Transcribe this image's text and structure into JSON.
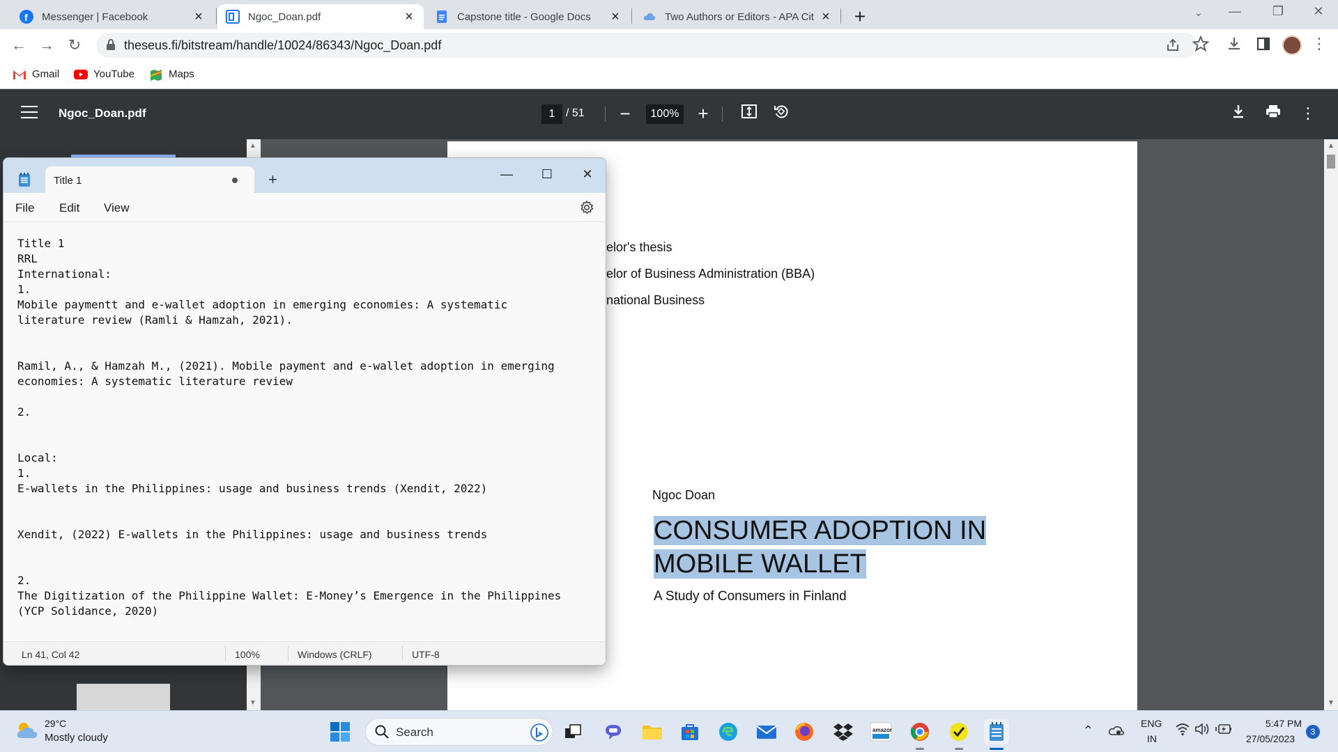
{
  "browser": {
    "tabs": [
      {
        "label": "Messenger | Facebook",
        "icon": "facebook-icon"
      },
      {
        "label": "Ngoc_Doan.pdf",
        "icon": "pdf-icon"
      },
      {
        "label": "Capstone title - Google Docs",
        "icon": "google-docs-icon"
      },
      {
        "label": "Two Authors or Editors - APA Cit",
        "icon": "cloud-icon"
      }
    ],
    "url": "theseus.fi/bitstream/handle/10024/86343/Ngoc_Doan.pdf",
    "bookmarks": [
      "Gmail",
      "YouTube",
      "Maps"
    ]
  },
  "pdf": {
    "title": "Ngoc_Doan.pdf",
    "page_current": "1",
    "page_total": "/ 51",
    "zoom": "100%",
    "page_lines": [
      "elor's thesis",
      "elor of Business Administration (BBA)",
      "national Business"
    ],
    "author": "Ngoc Doan",
    "doc_title_line1": "CONSUMER ADOPTION IN",
    "doc_title_line2": "MOBILE WALLET",
    "subtitle": "A Study of Consumers in Finland"
  },
  "notepad": {
    "tab_title": "Title 1",
    "menu": [
      "File",
      "Edit",
      "View"
    ],
    "lines": [
      "Title 1",
      "RRL",
      "International:",
      "1.",
      "Mobile paymentt and e-wallet adoption in emerging economies: A systematic",
      "literature review (Ramli & Hamzah, 2021).",
      "",
      "",
      "Ramil, A., & Hamzah M., (2021). Mobile payment and e-wallet adoption in emerging",
      "economies: A systematic literature review",
      "",
      "2.",
      "",
      "",
      "Local:",
      "1.",
      "E-wallets in the Philippines: usage and business trends (Xendit, 2022)",
      "",
      "",
      "Xendit, (2022) E-wallets in the Philippines: usage and business trends",
      "",
      "",
      "2.",
      "The Digitization of the Philippine Wallet: E-Money’s Emergence in the Philippines",
      "(YCP Solidance, 2020)"
    ],
    "status": {
      "position": "Ln 41, Col 42",
      "zoom": "100%",
      "line_ending": "Windows (CRLF)",
      "encoding": "UTF-8"
    }
  },
  "taskbar": {
    "weather_temp": "29°C",
    "weather_condition": "Mostly cloudy",
    "search_placeholder": "Search",
    "lang_line1": "ENG",
    "lang_line2": "IN",
    "time": "5:47 PM",
    "date": "27/05/2023",
    "notification_count": "3"
  },
  "colors": {
    "pdf_toolbar": "#323639",
    "pdf_background": "#525659",
    "title_highlight": "#a7c5e3",
    "notepad_titlebar": "#cfdff0",
    "taskbar": "#dfe7f2"
  }
}
